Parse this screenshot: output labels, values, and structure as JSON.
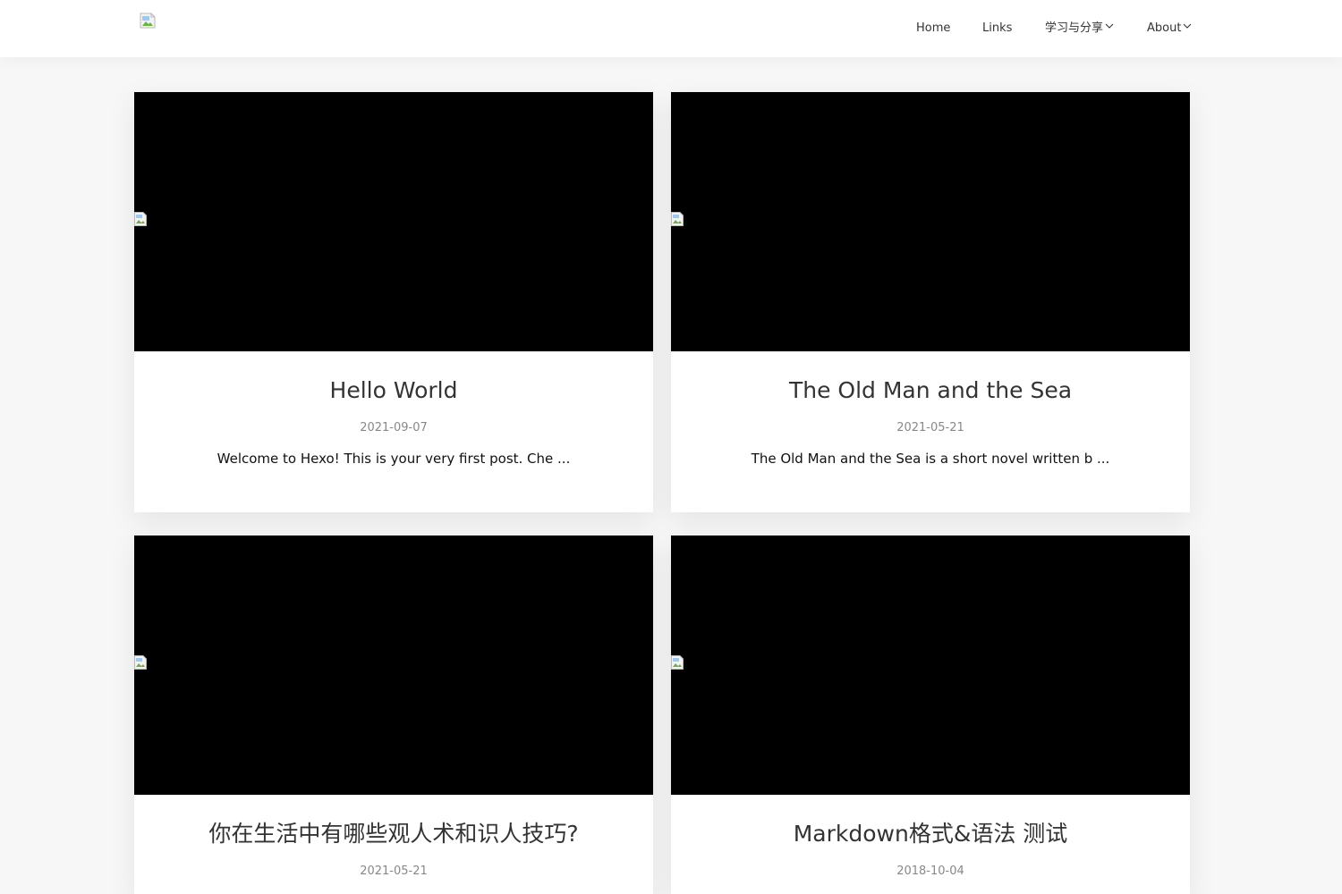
{
  "nav": {
    "home": "Home",
    "links": "Links",
    "learn": "学习与分享",
    "about": "About"
  },
  "icons": {
    "logo": "broken-image-icon",
    "dropdown": "chevron-down-icon",
    "cover": "broken-image-icon"
  },
  "colors": {
    "background": "#f7f7f7",
    "header": "#ffffff",
    "cover": "#000000",
    "date": "#888888"
  },
  "posts": [
    {
      "title": "Hello World",
      "date": "2021-09-07",
      "excerpt": "Welcome to Hexo! This is your very first post. Che ..."
    },
    {
      "title": "The Old Man and the Sea",
      "date": "2021-05-21",
      "excerpt": "The Old Man and the Sea is a short novel written b ..."
    },
    {
      "title": "你在生活中有哪些观人术和识人技巧?",
      "date": "2021-05-21",
      "excerpt": ""
    },
    {
      "title": "Markdown格式&语法 测试",
      "date": "2018-10-04",
      "excerpt": ""
    }
  ]
}
